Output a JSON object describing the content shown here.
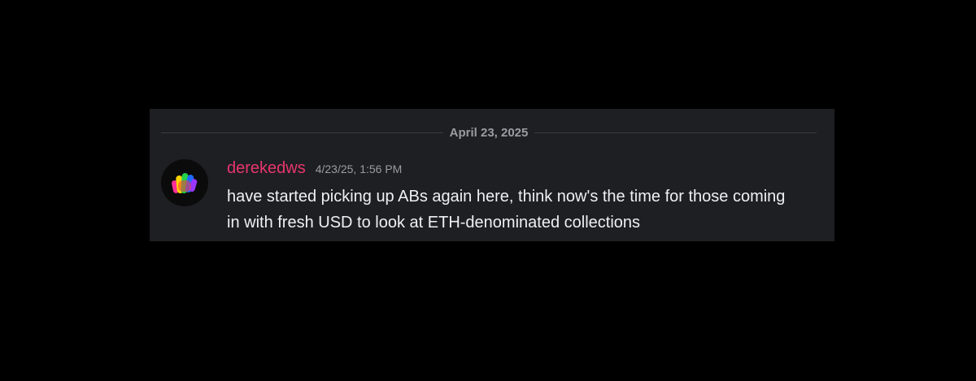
{
  "date_divider": {
    "label": "April 23, 2025"
  },
  "message": {
    "avatar_icon": "rainbow-brush-icon",
    "username": "derekedws",
    "username_color": "#e8356e",
    "timestamp": "4/23/25, 1:56 PM",
    "text": "have started picking up ABs again here, think now's the time for those coming in with fresh USD to look at ETH-denominated collections"
  },
  "colors": {
    "page_background": "#000000",
    "card_background": "#1e1f22",
    "text": "#eef0f2",
    "muted": "#9a9ca3"
  }
}
